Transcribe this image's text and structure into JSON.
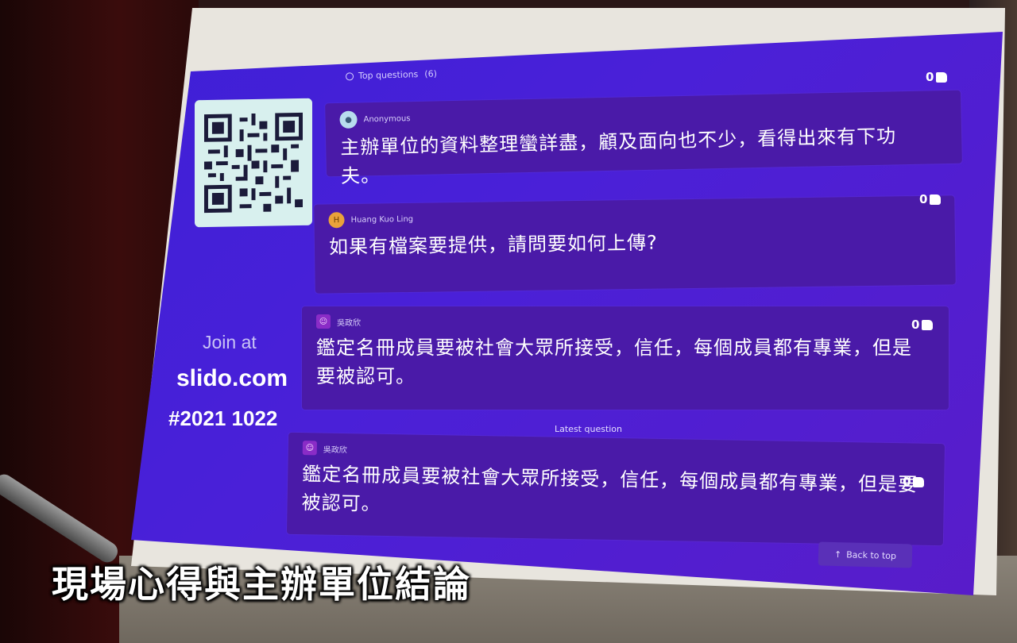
{
  "sidebar": {
    "join_label": "Join at",
    "join_url": "slido.com",
    "event_code": "#2021 1022"
  },
  "top_questions": {
    "label": "Top questions",
    "count": "(6)",
    "header_likes": "0"
  },
  "questions": [
    {
      "author": "Anonymous",
      "avatar": "person-icon",
      "text": "主辦單位的資料整理蠻詳盡，顧及面向也不少，看得出來有下功夫。",
      "likes": "0"
    },
    {
      "author": "Huang Kuo Ling",
      "avatar_initial": "H",
      "text": "如果有檔案要提供，請問要如何上傳?",
      "likes": "0"
    },
    {
      "author": "吳政欣",
      "avatar": "person-icon",
      "text": "鑑定名冊成員要被社會大眾所接受，信任，每個成員都有專業，但是要被認可。",
      "likes": "0"
    }
  ],
  "latest": {
    "label": "Latest question",
    "author": "吳政欣",
    "avatar": "person-icon",
    "text": "鑑定名冊成員要被社會大眾所接受，信任，每個成員都有專業，但是要被認可。",
    "likes": "0"
  },
  "back_to_top": "Back to top",
  "caption": "現場心得與主辦單位結論",
  "colors": {
    "slide_bg": "#4a20d8",
    "card_bg": "#4a1aa8",
    "qr_bg": "#d8f0ee"
  }
}
